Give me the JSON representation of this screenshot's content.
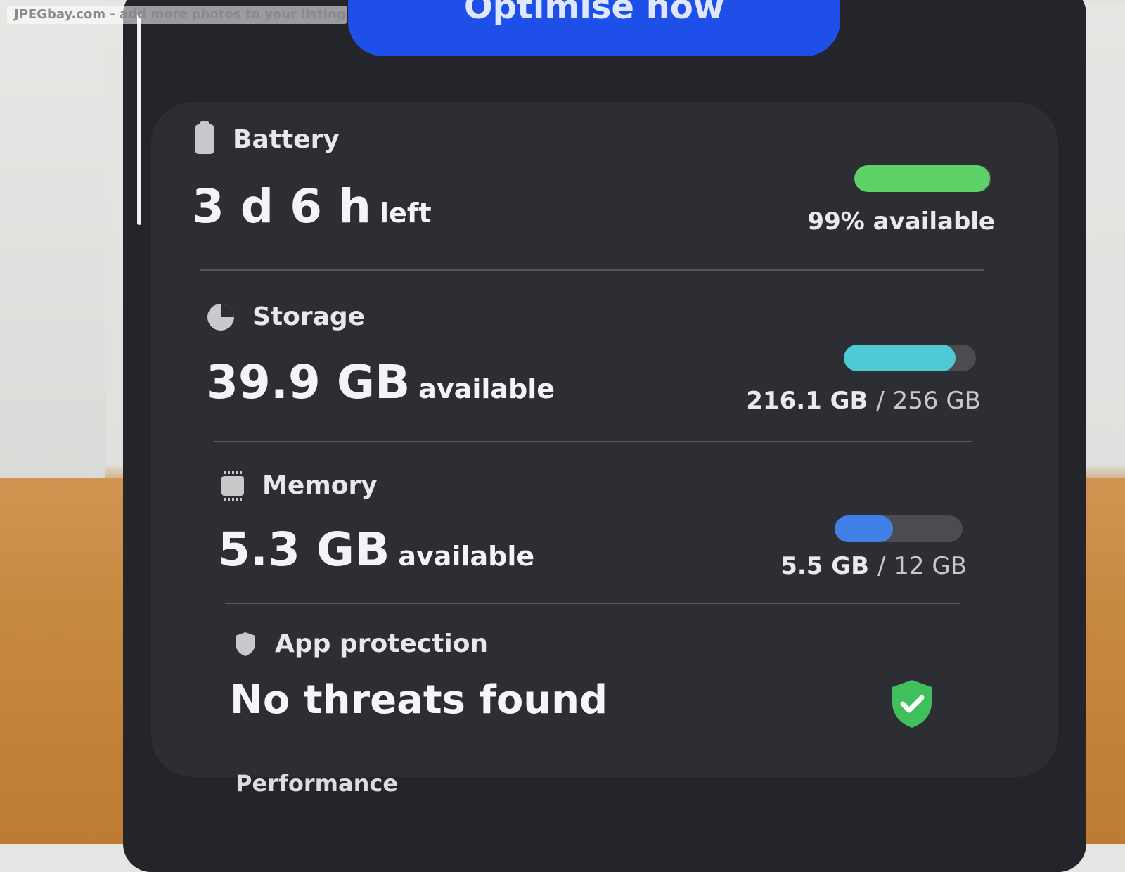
{
  "watermark": "JPEGbay.com - add more photos to your listings",
  "optimise_button": "Optimise now",
  "battery": {
    "title": "Battery",
    "value": "3 d 6 h",
    "suffix": "left",
    "caption": "99% available",
    "fill_percent": 99,
    "color": "#5ed168"
  },
  "storage": {
    "title": "Storage",
    "value": "39.9 GB",
    "suffix": "available",
    "used": "216.1 GB",
    "separator": "/",
    "total": "256 GB",
    "fill_fraction": 0.844,
    "color": "#4fc9d4"
  },
  "memory": {
    "title": "Memory",
    "value": "5.3 GB",
    "suffix": "available",
    "used": "5.5 GB",
    "separator": "/",
    "total": "12 GB",
    "fill_fraction": 0.458,
    "color": "#3f7fe6"
  },
  "app_protection": {
    "title": "App protection",
    "status": "No threats found",
    "status_color": "#3fc05a"
  },
  "performance_label": "Performance"
}
